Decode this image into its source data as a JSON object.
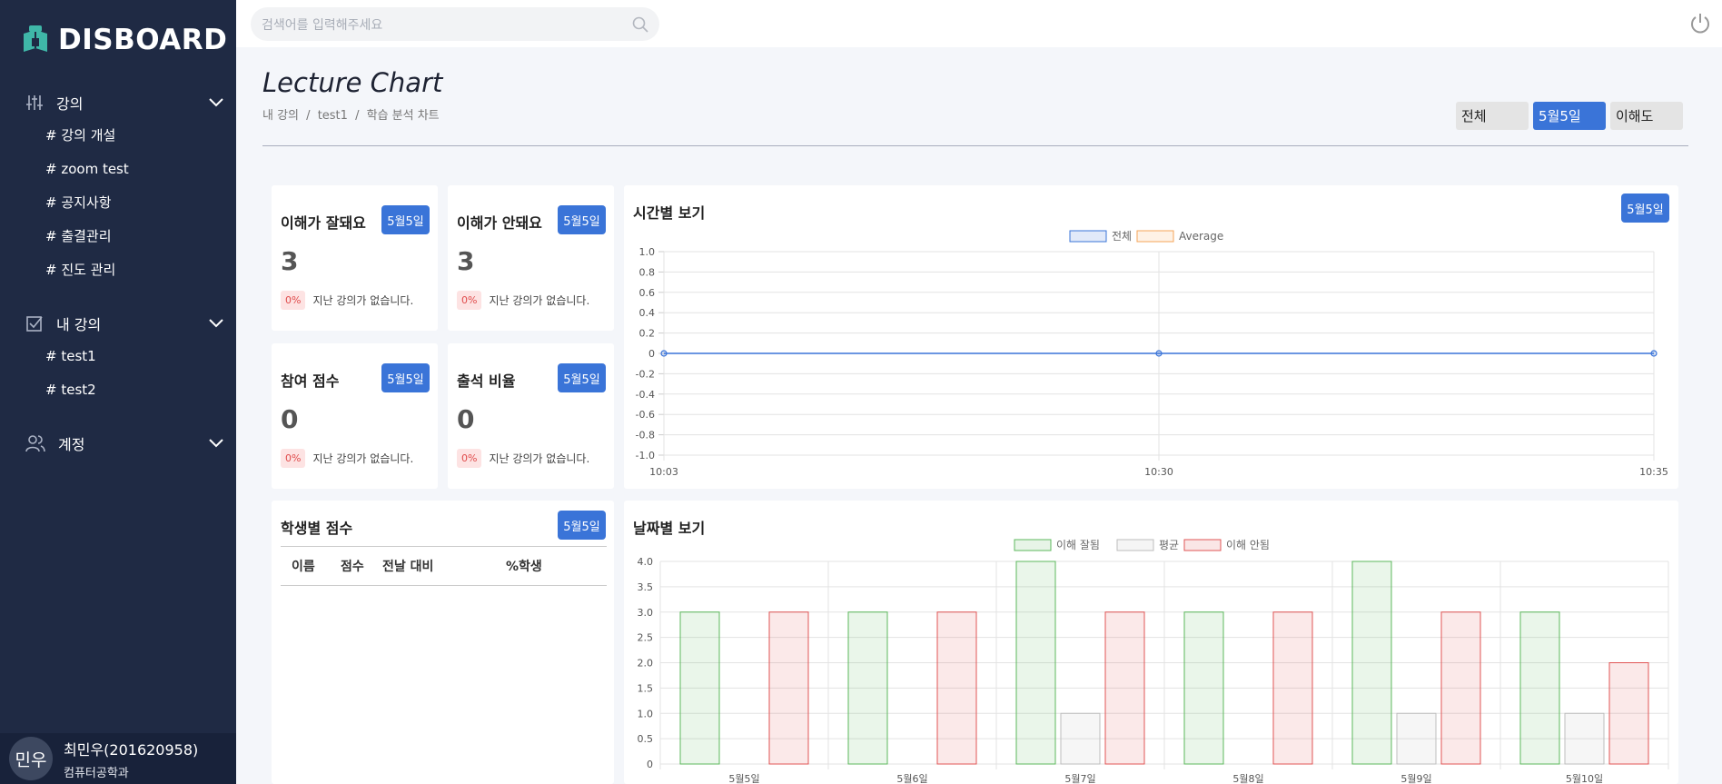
{
  "app": {
    "brand": "DISBOARD"
  },
  "sidebar": {
    "groups": [
      {
        "label": "강의",
        "icon": "sliders-icon",
        "items": [
          "# 강의 개설",
          "# zoom test",
          "# 공지사항",
          "# 출결관리",
          "# 진도 관리"
        ]
      },
      {
        "label": "내 강의",
        "icon": "checkbox-icon",
        "items": [
          "# test1",
          "# test2"
        ]
      },
      {
        "label": "계정",
        "icon": "users-icon",
        "items": []
      }
    ],
    "profile": {
      "avatar_text": "민우",
      "name": "최민우(201620958)",
      "dept": "컴퓨터공학과"
    }
  },
  "topbar": {
    "search_placeholder": "검색어를 입력해주세요"
  },
  "header": {
    "title": "Lecture Chart",
    "breadcrumb": [
      "내 강의",
      "/",
      "test1",
      "/",
      "학습 분석 차트"
    ],
    "filters": [
      "전체",
      "5월5일",
      "이해도"
    ],
    "active_filter": "5월5일"
  },
  "kpis": [
    {
      "title": "이해가 잘돼요",
      "tag": "5월5일",
      "value": "3",
      "pct": "0%",
      "note": "지난 강의가 없습니다."
    },
    {
      "title": "이해가 안돼요",
      "tag": "5월5일",
      "value": "3",
      "pct": "0%",
      "note": "지난 강의가 없습니다."
    },
    {
      "title": "참여 점수",
      "tag": "5월5일",
      "value": "0",
      "pct": "0%",
      "note": "지난 강의가 없습니다."
    },
    {
      "title": "출석 비율",
      "tag": "5월5일",
      "value": "0",
      "pct": "0%",
      "note": "지난 강의가 없습니다."
    }
  ],
  "student_scores": {
    "title": "학생별 점수",
    "tag": "5월5일",
    "columns": [
      "이름",
      "점수",
      "전날 대비",
      "%학생"
    ],
    "rows": []
  },
  "time_chart": {
    "title": "시간별 보기",
    "tag": "5월5일"
  },
  "date_chart": {
    "title": "날짜별 보기"
  },
  "colors": {
    "sidebar": "#1f2a44",
    "accent": "#3a74d8",
    "good": "#5cb85c",
    "bad": "#e05555",
    "avg": "#bdbdbd"
  },
  "chart_data": [
    {
      "type": "line",
      "x": [
        "10:03",
        "10:30",
        "10:35"
      ],
      "series": [
        {
          "name": "전체",
          "values": [
            0,
            0,
            0
          ],
          "color": "#3a74d8"
        },
        {
          "name": "Average",
          "values": [],
          "color": "#f5a55a"
        }
      ],
      "ylim": [
        -1.0,
        1.0
      ],
      "yticks": [
        "1.0",
        "0.8",
        "0.6",
        "0.4",
        "0.2",
        "0",
        "-0.2",
        "-0.4",
        "-0.6",
        "-0.8",
        "-1.0"
      ],
      "legend": "top-center",
      "grid": true
    },
    {
      "type": "bar",
      "categories": [
        "5월5일",
        "5월6일",
        "5월7일",
        "5월8일",
        "5월9일",
        "5월10일"
      ],
      "series": [
        {
          "name": "이해 잘됨",
          "values": [
            3,
            3,
            4,
            3,
            4,
            3
          ],
          "color": "#5cb85c"
        },
        {
          "name": "평균",
          "values": [
            0,
            0,
            1,
            0,
            1,
            1
          ],
          "color": "#bdbdbd"
        },
        {
          "name": "이해 안됨",
          "values": [
            3,
            3,
            3,
            3,
            3,
            2
          ],
          "color": "#e05555"
        }
      ],
      "ylim": [
        0,
        4.0
      ],
      "yticks": [
        "4.0",
        "3.5",
        "3.0",
        "2.5",
        "2.0",
        "1.5",
        "1.0",
        "0.5",
        "0"
      ],
      "legend": "top-center",
      "grid": true
    }
  ]
}
